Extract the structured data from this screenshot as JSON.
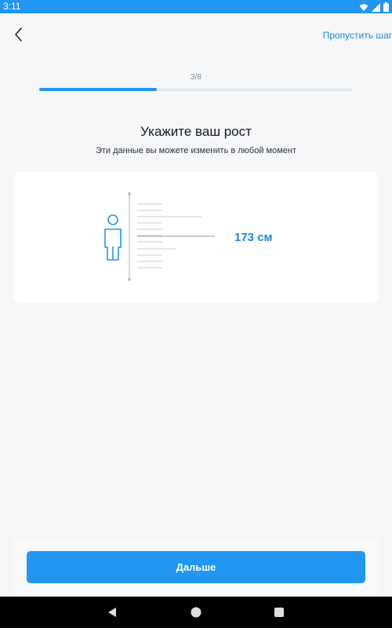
{
  "status": {
    "time": "3:11",
    "icons": [
      "wifi-icon",
      "signal-icon",
      "battery-icon"
    ]
  },
  "header": {
    "back_icon": "chevron-left-icon",
    "skip_label": "Пропустить шаг"
  },
  "progress": {
    "step_text": "3/8",
    "current": 3,
    "total": 8,
    "fraction": 0.375
  },
  "main": {
    "title": "Укажите ваш рост",
    "subtitle": "Эти данные вы можете изменить в любой момент"
  },
  "height_picker": {
    "value_text": "173 см",
    "figure_icon": "person-icon"
  },
  "footer": {
    "next_label": "Дальше"
  },
  "navigation": {
    "buttons": [
      "back-triangle-icon",
      "home-circle-icon",
      "recents-square-icon"
    ]
  },
  "colors": {
    "accent": "#2196f3",
    "value_blue": "#1e88e5",
    "background": "#f6f7f9"
  }
}
